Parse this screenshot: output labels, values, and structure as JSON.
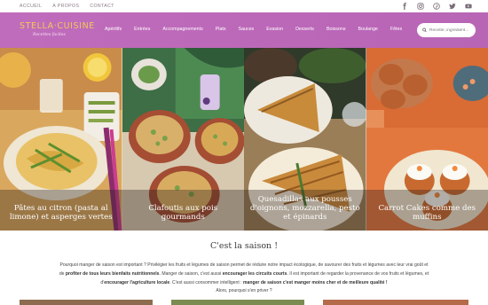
{
  "topbar": {
    "links": [
      "ACCUEIL",
      "A PROPOS",
      "CONTACT"
    ],
    "social_icons": [
      "facebook-icon",
      "instagram-icon",
      "pinterest-icon",
      "twitter-icon",
      "youtube-icon"
    ]
  },
  "logo": {
    "title": "STELLA·CUISINE",
    "subtitle": "Recettes faciles"
  },
  "menu": [
    "Apéritifs",
    "Entrées",
    "Accompagnements",
    "Plats",
    "Sauces",
    "Evasion",
    "Desserts",
    "Boissons",
    "Boulange",
    "Fêtes"
  ],
  "search": {
    "placeholder": "Recette, ingrédient..."
  },
  "colors": {
    "nav": "#bf6bbb",
    "logo": "#f1c85a",
    "text": "#444444"
  },
  "hero_cards": [
    {
      "title": "Pâtes au citron (pasta al limone) et asperges vertes"
    },
    {
      "title": "Clafoutis aux pois gourmands"
    },
    {
      "title": "Quesadillas aux pousses d'oignons, mozzarella, pesto et épinards"
    },
    {
      "title": "Carrot Cakes comme des muffins"
    }
  ],
  "saison": {
    "title": "C'est la saison !",
    "p1_a": "Pourquoi manger de saison est important ? Privilégier les fruits et légumes de saison permet de réduire notre impact écologique, de savourer des fruits et légumes avec leur vrai goût et",
    "p2_a": "de ",
    "p2_b": "profiter de tous leurs bienfaits nutritionnels",
    "p2_c": ". Manger de saison, c'est aussi ",
    "p2_d": "encourager les circuits courts",
    "p2_e": ". Il est important de regarder la provenance de vos fruits et légumes, et",
    "p3_a": "d'",
    "p3_b": "encourager l'agriculture locale",
    "p3_c": ". C'est aussi consommer intelligent : ",
    "p3_d": "manger de saison c'est manger moins cher et de meilleure qualité !",
    "p4": "Alors, pourquoi s'en priver ?"
  }
}
